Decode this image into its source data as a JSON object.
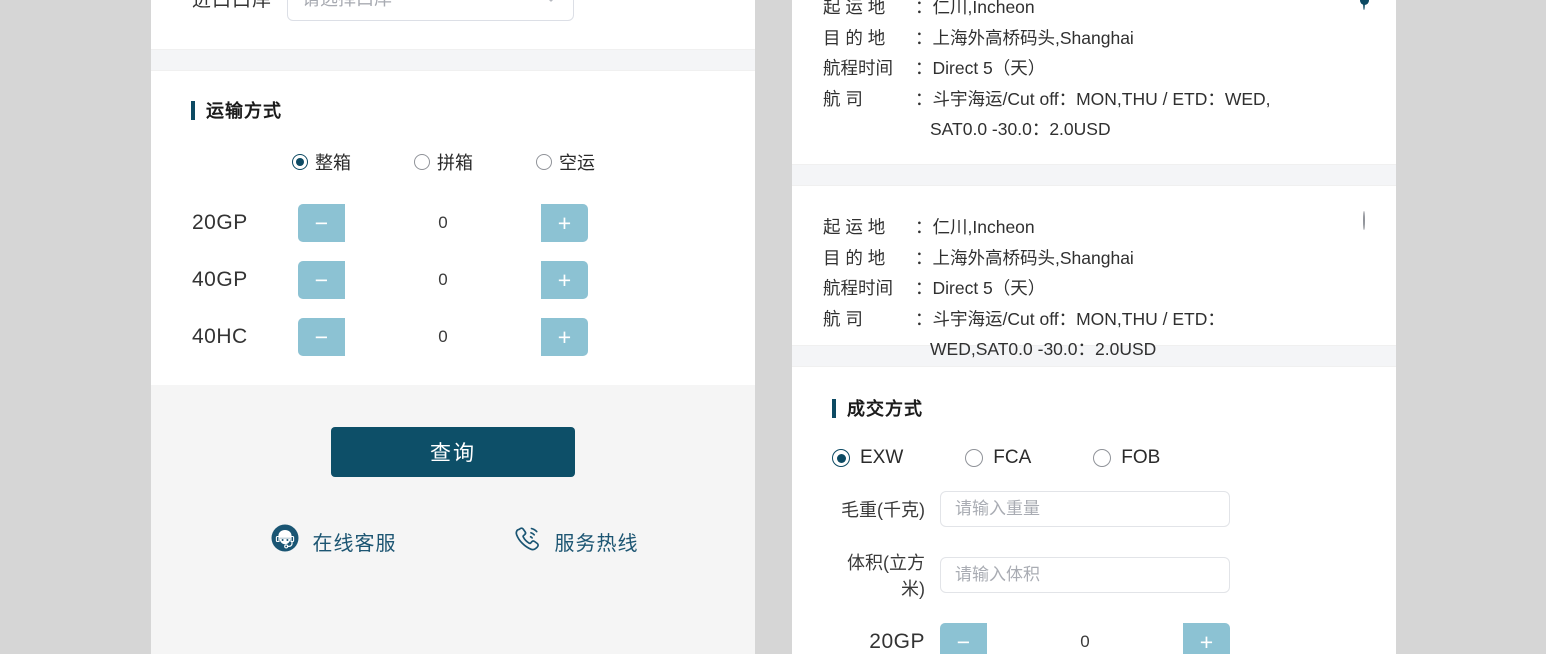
{
  "colors": {
    "page_bg": "#d6d6d6",
    "panel_bg": "#ffffff",
    "band_bg": "#f4f5f7",
    "accent_dark": "#0d4a63",
    "primary_button": "#0d4f68",
    "stepper_button": "#8cc2d3",
    "section_bottom_bg": "#f5f5f5"
  },
  "left_panel": {
    "port_field": {
      "label": "进口口岸",
      "placeholder": "请选择口岸",
      "value": "请选择口岸",
      "chevron_icon": "chevron-down-icon"
    },
    "transport_section": {
      "title": "运输方式",
      "options": [
        {
          "label": "整箱",
          "selected": true
        },
        {
          "label": "拼箱",
          "selected": false
        },
        {
          "label": "空运",
          "selected": false
        }
      ],
      "steppers": [
        {
          "label": "20GP",
          "minus": "−",
          "value": "0",
          "plus": "+"
        },
        {
          "label": "40GP",
          "minus": "−",
          "value": "0",
          "plus": "+"
        },
        {
          "label": "40HC",
          "minus": "−",
          "value": "0",
          "plus": "+"
        }
      ]
    },
    "actions": {
      "query_button": "查询",
      "services": [
        {
          "label": "在线客服",
          "icon": "headset-support-icon"
        },
        {
          "label": "服务热线",
          "icon": "phone-hotline-icon"
        }
      ]
    }
  },
  "right_panel": {
    "routes": [
      {
        "selected": true,
        "origin_key": "起 运 地",
        "origin_value": "仁川,Incheon",
        "destination_key": "目 的 地",
        "destination_value": "上海外高桥码头,Shanghai",
        "transit_key": "航程时间",
        "transit_value": "Direct  5（天）",
        "carrier_key": "航      司",
        "carrier_value": "斗宇海运/Cut off：MON,THU / ETD：WED,",
        "carrier_value_cont": "SAT0.0 -30.0：2.0USD"
      },
      {
        "selected": false,
        "origin_key": "起 运 地",
        "origin_value": "仁川,Incheon",
        "destination_key": "目 的 地",
        "destination_value": "上海外高桥码头,Shanghai",
        "transit_key": "航程时间",
        "transit_value": "Direct  5（天）",
        "carrier_key": "航      司",
        "carrier_value": "斗宇海运/Cut off：MON,THU / ETD：",
        "carrier_value_cont": "WED,SAT0.0 -30.0：2.0USD"
      }
    ],
    "terms_section": {
      "title": "成交方式",
      "options": [
        {
          "label": "EXW",
          "selected": true
        },
        {
          "label": "FCA",
          "selected": false
        },
        {
          "label": "FOB",
          "selected": false
        }
      ],
      "inputs": [
        {
          "label": "毛重(千克)",
          "placeholder": "请输入重量",
          "value": ""
        },
        {
          "label": "体积(立方米)",
          "placeholder": "请输入体积",
          "value": ""
        }
      ],
      "steppers": [
        {
          "label": "20GP",
          "minus": "−",
          "value": "0",
          "plus": "+"
        }
      ]
    }
  }
}
